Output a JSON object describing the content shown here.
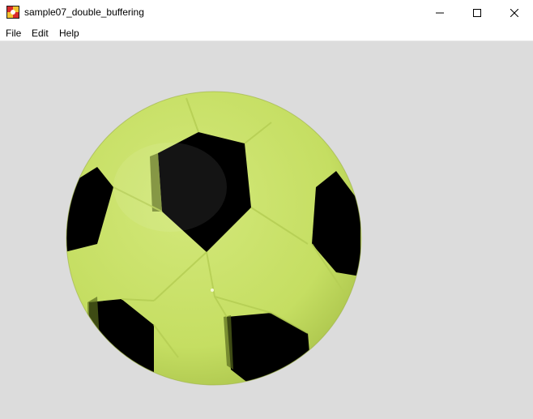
{
  "window": {
    "title": "sample07_double_buffering",
    "app_icon": "app-icon",
    "controls": {
      "minimize_icon": "minimize-icon",
      "maximize_icon": "maximize-icon",
      "close_icon": "close-icon"
    }
  },
  "menu": {
    "items": [
      {
        "label": "File"
      },
      {
        "label": "Edit"
      },
      {
        "label": "Help"
      }
    ]
  },
  "canvas": {
    "background": "#dcdcdc",
    "ball": {
      "name": "soccer-ball-image",
      "primary_color": "#c9e26a",
      "patch_color": "#000000"
    }
  }
}
